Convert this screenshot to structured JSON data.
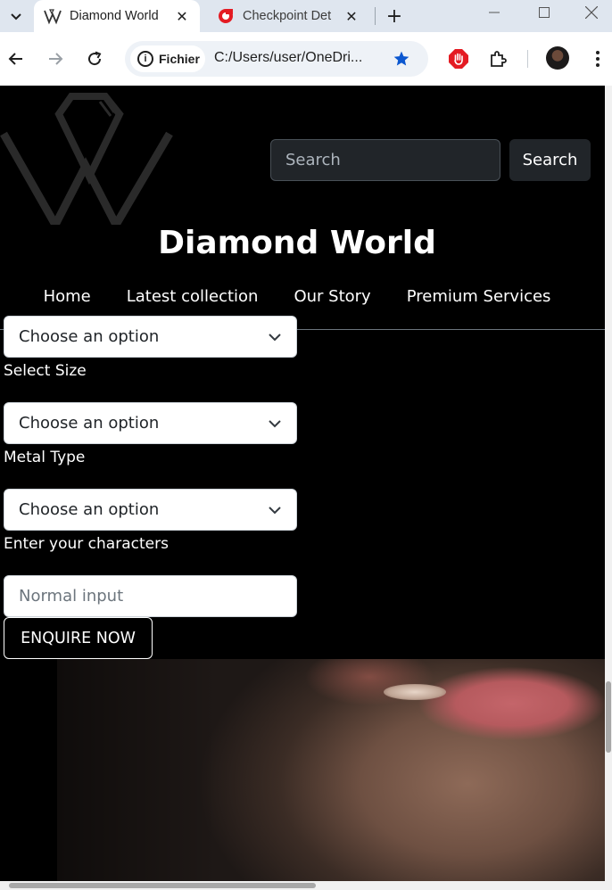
{
  "browser": {
    "tabs": [
      {
        "title": "Diamond World",
        "active": true
      },
      {
        "title": "Checkpoint Det",
        "active": false
      }
    ],
    "address": {
      "chip_label": "Fichier",
      "url": "C:/Users/user/OneDri..."
    },
    "colors": {
      "tabstrip": "#dfe6ef",
      "accent": "#0b57d0"
    }
  },
  "site": {
    "search": {
      "placeholder": "Search",
      "button_label": "Search"
    },
    "title": "Diamond World",
    "nav": [
      "Home",
      "Latest collection",
      "Our Story",
      "Premium Services"
    ]
  },
  "form": {
    "select_first": {
      "value": "Choose an option"
    },
    "size_label": "Select Size",
    "size_select": {
      "value": "Choose an option"
    },
    "metal_label": "Metal Type",
    "metal_select": {
      "value": "Choose an option"
    },
    "characters_label": "Enter your characters",
    "characters_input": {
      "placeholder": "Normal input"
    },
    "enquire_label": "ENQUIRE NOW"
  }
}
